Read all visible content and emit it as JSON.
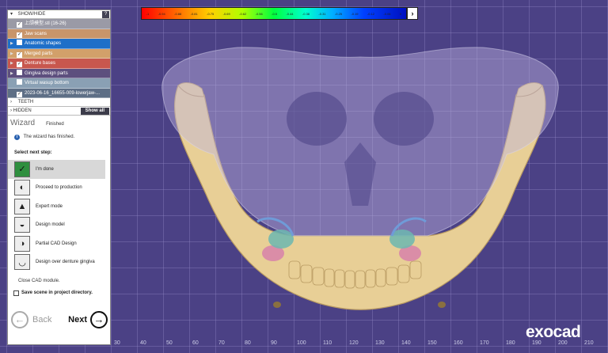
{
  "colors": {
    "viewport_bg": "#4b4185",
    "accent_blue": "#1e6fc8"
  },
  "colorbar": {
    "ticks": [
      "-1",
      "-0.94",
      "-0.88",
      "-0.81",
      "-0.75",
      "-0.69",
      "-0.62",
      "-0.56",
      "-0.5",
      "-0.44",
      "-0.38",
      "-0.31",
      "-0.25",
      "-0.19",
      "-0.12",
      "-0.06",
      "0"
    ],
    "expand_icon": "chevron-right-icon"
  },
  "panel": {
    "show_hide_label": "SHOW/HIDE",
    "help_label": "?",
    "objects": [
      {
        "label": "上颌模型.stl (16-26)",
        "checked": true,
        "expandable": false,
        "color": "#9a9aa6"
      },
      {
        "label": "Jaw scans",
        "checked": true,
        "expandable": false,
        "color": "#c8956a"
      },
      {
        "label": "Anatomic shapes",
        "checked": false,
        "expandable": true,
        "color": "#1e6fc8"
      },
      {
        "label": "Merged parts",
        "checked": true,
        "expandable": true,
        "color": "#d2a06a"
      },
      {
        "label": "Denture bases",
        "checked": true,
        "expandable": true,
        "color": "#c8574e"
      },
      {
        "label": "Gingiva design parts",
        "checked": false,
        "expandable": true,
        "color": "#5d4f7e"
      },
      {
        "label": "Virtual wasup bottom",
        "checked": false,
        "expandable": false,
        "color": "#8aa0b4"
      },
      {
        "label": "2023-06-16_16655-009-lowerjaw-...",
        "checked": true,
        "expandable": false,
        "color": "#5e6f86"
      }
    ],
    "teeth_label": "TEETH",
    "hidden_label": "HIDDEN",
    "show_all_label": "Show all"
  },
  "wizard": {
    "title": "Wizard",
    "status": "Finished",
    "info": "The wizard has finished.",
    "select_next": "Select next step:",
    "steps": [
      {
        "label": "I'm done",
        "icon": "check-icon",
        "active": true
      },
      {
        "label": "Proceed to production",
        "icon": "palette-icon",
        "active": false
      },
      {
        "label": "Expert mode",
        "icon": "graduation-cap-icon",
        "active": false
      },
      {
        "label": "Design model",
        "icon": "model-icon",
        "active": false
      },
      {
        "label": "Partial CAD Design",
        "icon": "partial-cad-icon",
        "active": false
      },
      {
        "label": "Design over denture gingiva",
        "icon": "gingiva-icon",
        "active": false
      }
    ],
    "close_cad": "Close CAD module.",
    "save_scene": "Save scene in project directory.",
    "back_label": "Back",
    "next_label": "Next"
  },
  "axis_labels": [
    "30",
    "40",
    "50",
    "60",
    "70",
    "80",
    "90",
    "100",
    "110",
    "120",
    "130",
    "140",
    "150",
    "160",
    "170",
    "180",
    "190",
    "200",
    "210"
  ],
  "brand": "exocad"
}
